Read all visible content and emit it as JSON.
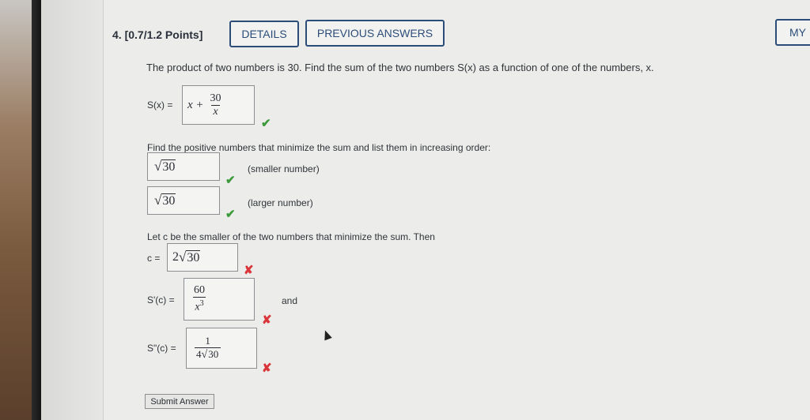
{
  "question": {
    "number_points": "4. [0.7/1.2 Points]",
    "details_label": "DETAILS",
    "previous_answers_label": "PREVIOUS ANSWERS",
    "my_label": "MY",
    "prompt": "The product of two numbers is 30. Find the sum of the two numbers S(x) as a function of one of the numbers, x."
  },
  "part1": {
    "label": "S(x) =",
    "answer_prefix": "x +",
    "answer_num": "30",
    "answer_den": "x",
    "status": "correct"
  },
  "part2": {
    "prompt": "Find the positive numbers that minimize the sum and list them in increasing order:",
    "smaller_value": "30",
    "smaller_label": "(smaller number)",
    "larger_value": "30",
    "larger_label": "(larger number)"
  },
  "part3": {
    "prompt": "Let c be the smaller of the two numbers that minimize the sum. Then",
    "c_label": "c =",
    "c_coef": "2",
    "c_rad": "30",
    "sprime_label": "S'(c) =",
    "sprime_num": "60",
    "sprime_den": "x",
    "sprime_exp": "3",
    "and_label": "and",
    "sdouble_label": "S\"(c) =",
    "sdouble_num": "1",
    "sdouble_coef": "4",
    "sdouble_rad": "30"
  },
  "submit_label": "Submit Answer",
  "icons": {
    "check": "✔",
    "cross": "✘"
  },
  "colors": {
    "accent": "#2c4d7a",
    "correct": "#3c9a3c",
    "incorrect": "#d9353a"
  }
}
